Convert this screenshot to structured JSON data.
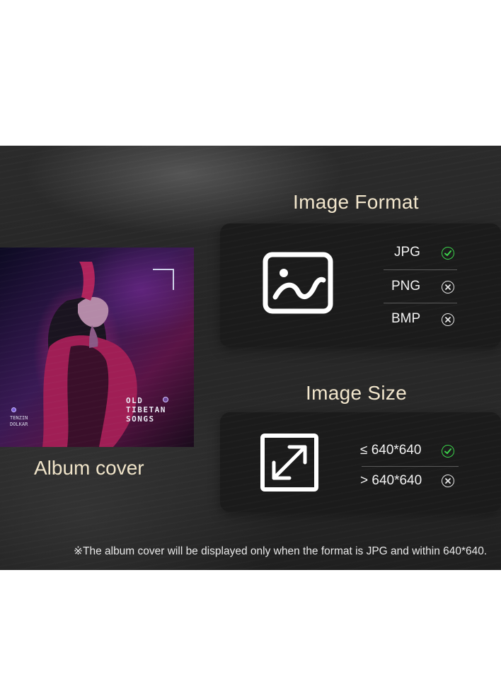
{
  "left": {
    "album_label": "Album cover",
    "album_art": {
      "title_lines": [
        "OLD",
        "TIBETAN",
        "SONGS"
      ],
      "artist_lines": [
        "TENZIN",
        "DOLKAR"
      ]
    }
  },
  "format": {
    "title": "Image Format",
    "icon": "image-icon",
    "options": [
      {
        "label": "JPG",
        "status": "ok"
      },
      {
        "label": "PNG",
        "status": "no"
      },
      {
        "label": "BMP",
        "status": "no"
      }
    ]
  },
  "size": {
    "title": "Image Size",
    "icon": "expand-icon",
    "options": [
      {
        "label": "≤ 640*640",
        "status": "ok"
      },
      {
        "label": "> 640*640",
        "status": "no"
      }
    ]
  },
  "footnote": "※The album cover will be displayed only when the format is JPG and within 640*640.",
  "colors": {
    "ok": "#3bd24a",
    "no": "#e8e8e8",
    "title": "#f2e6cc"
  }
}
